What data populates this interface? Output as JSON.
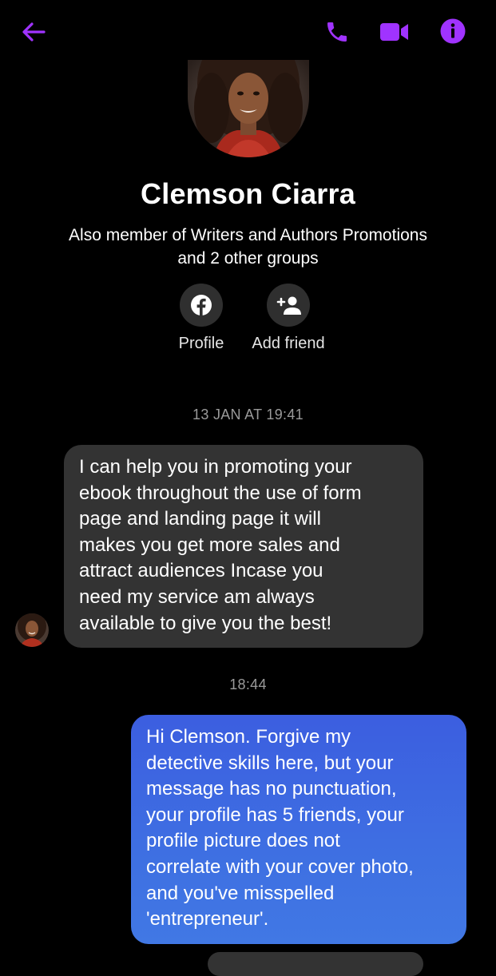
{
  "header": {
    "back_icon": "arrow-left-icon",
    "call_icon": "phone-icon",
    "video_icon": "video-camera-icon",
    "info_icon": "info-icon",
    "accent_color": "#a033ff"
  },
  "contact": {
    "name": "Clemson Ciarra",
    "groups_line1": "Also member of Writers and Authors Promotions",
    "groups_line2": "and 2 other groups"
  },
  "actions": [
    {
      "label": "Profile",
      "icon": "facebook-icon"
    },
    {
      "label": "Add friend",
      "icon": "add-person-icon"
    }
  ],
  "conversation": {
    "timestamp_1": "13 JAN AT 19:41",
    "incoming": {
      "lines": [
        "I can help you in promoting your",
        "ebook throughout the use of form",
        "page and landing page it will",
        "makes you get more sales and",
        "attract audiences Incase you",
        "need my service am always",
        "available to give you the best!"
      ]
    },
    "timestamp_2": "18:44",
    "outgoing": {
      "lines": [
        "Hi Clemson. Forgive my",
        "detective skills here, but your",
        "message has no punctuation,",
        "your profile has 5 friends, your",
        "profile picture does not",
        "correlate with your cover photo,",
        "and you've misspelled",
        "'entrepreneur'."
      ]
    }
  },
  "colors": {
    "background": "#000000",
    "incoming_bubble": "#333333",
    "outgoing_bubble": "#3e6ae1",
    "timestamp": "#9a9a9a"
  }
}
